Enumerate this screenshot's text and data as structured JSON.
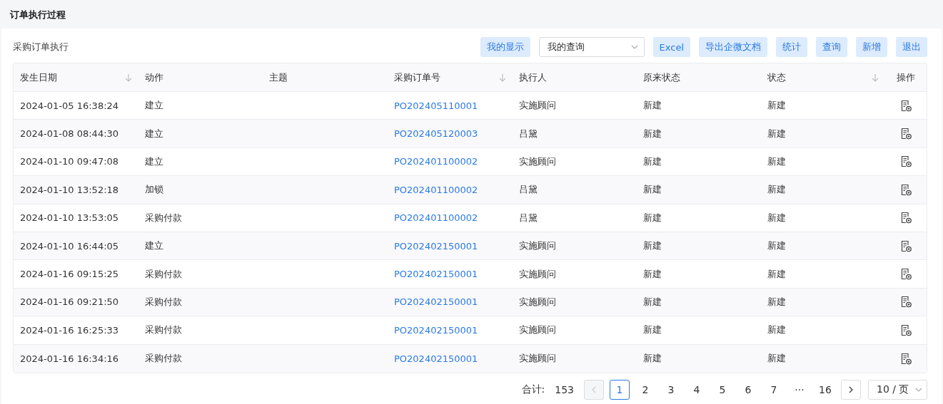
{
  "page_title": "订单执行过程",
  "panel_title": "采购订单执行",
  "toolbar": [
    {
      "kind": "button",
      "label": "我的显示"
    },
    {
      "kind": "select",
      "value": "我的查询"
    },
    {
      "kind": "button",
      "label": "Excel"
    },
    {
      "kind": "button",
      "label": "导出企微文档"
    },
    {
      "kind": "button",
      "label": "统计"
    },
    {
      "kind": "button",
      "label": "查询"
    },
    {
      "kind": "button",
      "label": "新增"
    },
    {
      "kind": "button",
      "label": "退出"
    }
  ],
  "table": {
    "columns": [
      {
        "label": "发生日期",
        "sortable": true
      },
      {
        "label": "动作",
        "sortable": false
      },
      {
        "label": "主题",
        "sortable": false
      },
      {
        "label": "采购订单号",
        "sortable": true
      },
      {
        "label": "执行人",
        "sortable": false
      },
      {
        "label": "原来状态",
        "sortable": false
      },
      {
        "label": "状态",
        "sortable": true
      },
      {
        "label": "操作",
        "sortable": false
      }
    ],
    "rows": [
      {
        "date": "2024-01-05 16:38:24",
        "action": "建立",
        "order": "PO202405110001",
        "executor": "实施顾问",
        "old_status": "新建",
        "status": "新建"
      },
      {
        "date": "2024-01-08 08:44:30",
        "action": "建立",
        "order": "PO202405120003",
        "executor": "吕黛",
        "old_status": "新建",
        "status": "新建"
      },
      {
        "date": "2024-01-10 09:47:08",
        "action": "建立",
        "order": "PO202401100002",
        "executor": "实施顾问",
        "old_status": "新建",
        "status": "新建"
      },
      {
        "date": "2024-01-10 13:52:18",
        "action": "加锁",
        "order": "PO202401100002",
        "executor": "吕黛",
        "old_status": "新建",
        "status": "新建"
      },
      {
        "date": "2024-01-10 13:53:05",
        "action": "采购付款",
        "order": "PO202401100002",
        "executor": "吕黛",
        "old_status": "新建",
        "status": "新建"
      },
      {
        "date": "2024-01-10 16:44:05",
        "action": "建立",
        "order": "PO202402150001",
        "executor": "实施顾问",
        "old_status": "新建",
        "status": "新建"
      },
      {
        "date": "2024-01-16 09:15:25",
        "action": "采购付款",
        "order": "PO202402150001",
        "executor": "实施顾问",
        "old_status": "新建",
        "status": "新建"
      },
      {
        "date": "2024-01-16 09:21:50",
        "action": "采购付款",
        "order": "PO202402150001",
        "executor": "实施顾问",
        "old_status": "新建",
        "status": "新建"
      },
      {
        "date": "2024-01-16 16:25:33",
        "action": "采购付款",
        "order": "PO202402150001",
        "executor": "实施顾问",
        "old_status": "新建",
        "status": "新建"
      },
      {
        "date": "2024-01-16 16:34:16",
        "action": "采购付款",
        "order": "PO202402150001",
        "executor": "实施顾问",
        "old_status": "新建",
        "status": "新建"
      }
    ]
  },
  "pagination": {
    "total_label": "合计:",
    "total": "153",
    "prev_disabled": true,
    "pages": [
      {
        "label": "1",
        "selected": true
      },
      {
        "label": "2",
        "selected": false
      },
      {
        "label": "3",
        "selected": false
      },
      {
        "label": "4",
        "selected": false
      },
      {
        "label": "5",
        "selected": false
      },
      {
        "label": "6",
        "selected": false
      },
      {
        "label": "7",
        "selected": false
      },
      {
        "label": "···",
        "selected": false
      },
      {
        "label": "16",
        "selected": false
      }
    ],
    "page_size": "10 / 页"
  }
}
